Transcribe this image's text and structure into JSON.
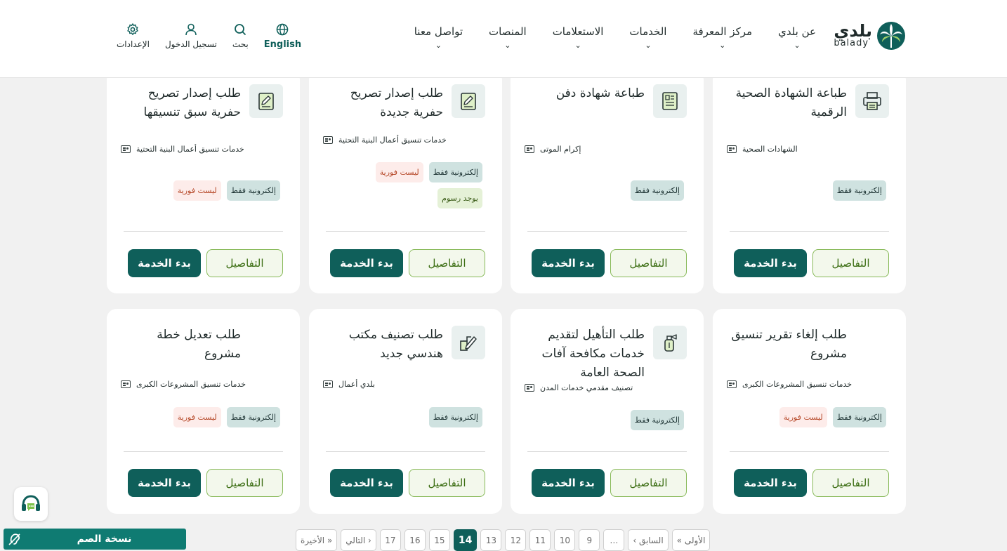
{
  "header": {
    "logo_ar": "بلدي",
    "logo_en": "balady",
    "nav": [
      {
        "label": "عن بلدي"
      },
      {
        "label": "مركز المعرفة"
      },
      {
        "label": "الخدمات"
      },
      {
        "label": "الاستعلامات"
      },
      {
        "label": "المنصات"
      },
      {
        "label": "تواصل معنا"
      }
    ],
    "tools": {
      "english": "English",
      "search": "بحث",
      "login": "تسجيل الدخول",
      "settings": "الإعدادات"
    }
  },
  "cards": [
    {
      "title": "طباعة الشهادة الصحية الرقمية",
      "category": "الشهادات الصحية",
      "icon": "printer-icon",
      "badges": [
        "إلكترونية فقط"
      ]
    },
    {
      "title": "طباعة شهادة دفن",
      "category": "إكرام الموتى",
      "icon": "document-list-icon",
      "badges": [
        "إلكترونية فقط"
      ]
    },
    {
      "title": "طلب إصدار تصريح حفرية جديدة",
      "category": "خدمات تنسيق أعمال البنية التحتية",
      "icon": "permit-doc-icon",
      "badges": [
        "إلكترونية فقط",
        "ليست فورية",
        "يوجد رسوم"
      ]
    },
    {
      "title": "طلب إصدار تصريح حفرية سبق تنسيقها",
      "category": "خدمات تنسيق أعمال البنية التحتية",
      "icon": "permit-doc-icon",
      "badges": [
        "إلكترونية فقط",
        "ليست فورية"
      ]
    },
    {
      "title": "طلب إلغاء تقرير تنسيق مشروع",
      "category": "خدمات تنسيق المشروعات الكبرى",
      "icon": "",
      "badges": [
        "إلكترونية فقط",
        "ليست فورية"
      ]
    },
    {
      "title": "طلب التأهيل لتقديم خدمات مكافحة آفات الصحة العامة",
      "category": "تصنيف مقدمي خدمات المدن",
      "icon": "spray-icon",
      "badges": [
        "إلكترونية فقط"
      ]
    },
    {
      "title": "طلب تصنيف مكتب هندسي جديد",
      "category": "بلدي أعمال",
      "icon": "edit-box-icon",
      "badges": [
        "إلكترونية فقط"
      ]
    },
    {
      "title": "طلب تعديل خطة مشروع",
      "category": "خدمات تنسيق المشروعات الكبرى",
      "icon": "",
      "badges": [
        "إلكترونية فقط",
        "ليست فورية"
      ]
    }
  ],
  "buttons": {
    "start": "بدء الخدمة",
    "details": "التفاصيل"
  },
  "pagination": {
    "first": "« الأولى",
    "prev": "‹ السابق",
    "ellipsis": "…",
    "pages": [
      "9",
      "10",
      "11",
      "12",
      "13",
      "14",
      "15",
      "16",
      "17"
    ],
    "current": "14",
    "next": "التالي ›",
    "last": "الأخيرة »"
  },
  "deaf_version": "نسخة الصم",
  "colors": {
    "primary": "#0f5f5a",
    "details_border": "#87b958",
    "badge_electronic": "#cfe2e0",
    "badge_not_instant": "#fdecea",
    "badge_fees": "#e5f1d7"
  }
}
